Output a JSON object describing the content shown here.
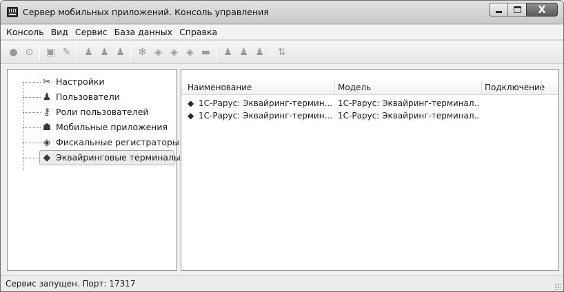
{
  "window": {
    "title": "Сервер мобильных приложений. Консоль управления",
    "close_symbol": "X"
  },
  "menu": {
    "items": [
      "Консоль",
      "Вид",
      "Сервис",
      "База данных",
      "Справка"
    ]
  },
  "toolbar": {
    "icons": [
      "record-icon",
      "stop-icon",
      "monitor-icon",
      "brush-icon",
      "users-group-icon",
      "user-edit-icon",
      "user-delete-icon",
      "settings-gear-icon",
      "add-device-icon",
      "edit-device-icon",
      "remove-device-icon",
      "card-icon",
      "user-add-icon",
      "user-edit2-icon",
      "user-remove-icon",
      "refresh-icon"
    ]
  },
  "tree": {
    "items": [
      {
        "label": "Настройки",
        "icon": "tools-icon"
      },
      {
        "label": "Пользователи",
        "icon": "user-icon"
      },
      {
        "label": "Роли пользователей",
        "icon": "key-icon"
      },
      {
        "label": "Мобильные приложения",
        "icon": "android-icon"
      },
      {
        "label": "Фискальные регистраторы",
        "icon": "register-icon"
      },
      {
        "label": "Эквайринговые терминалы",
        "icon": "terminal-icon"
      }
    ],
    "selected_index": 5
  },
  "list": {
    "columns": [
      "Наименование",
      "Модель",
      "Подключение"
    ],
    "rows": [
      {
        "name": "1С-Рарус: Эквайринг-термин...",
        "model": "1С-Рарус: Эквайринг-терминал...",
        "connection": ""
      },
      {
        "name": "1С-Рарус: Эквайринг-термин...",
        "model": "1С-Рарус: Эквайринг-терминал...",
        "connection": ""
      }
    ]
  },
  "status": {
    "text": "Сервис запущен. Порт: 17317"
  }
}
